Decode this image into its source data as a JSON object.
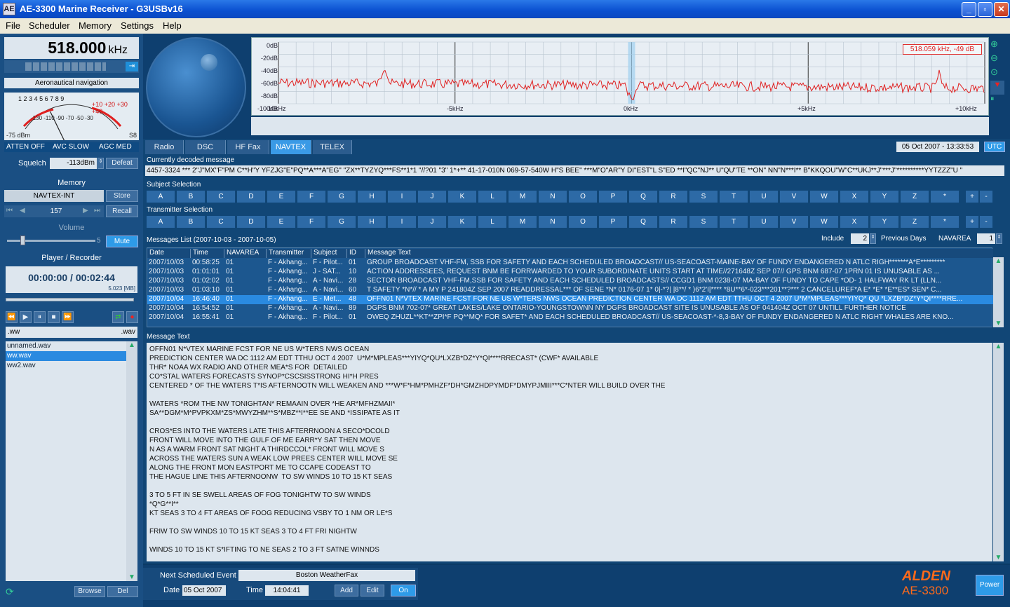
{
  "window": {
    "title": "AE-3300 Marine Receiver - G3USBv16",
    "icon": "AE",
    "min": "_",
    "max": "▫",
    "close": "✕"
  },
  "menu": [
    "File",
    "Scheduler",
    "Memory",
    "Settings",
    "Help"
  ],
  "freq": {
    "value": "518.000",
    "unit": "kHz",
    "mode_label": "Aeronautical navigation"
  },
  "meter": {
    "scale_left": [
      "1",
      "2",
      "3",
      "4",
      "5",
      "6",
      "7",
      "8",
      "9"
    ],
    "scale_right": [
      "+10",
      "+20",
      "+30",
      "+40"
    ],
    "scale_bottom": [
      "-130",
      "-110",
      "-90",
      "-70",
      "-50",
      "-30"
    ],
    "min_label": "-75",
    "unit": "dBm",
    "max_label": "S8",
    "atten": "ATTEN OFF",
    "avc": "AVC SLOW",
    "agc": "AGC MED",
    "needle_level": 0.38
  },
  "squelch": {
    "label": "Squelch",
    "value": "-113dBm",
    "defeat": "Defeat"
  },
  "memory": {
    "title": "Memory",
    "name": "NAVTEX-INT",
    "store": "Store",
    "number": "157",
    "recall": "Recall"
  },
  "volume": {
    "label": "Volume",
    "value": "5",
    "mute": "Mute",
    "level": 0.15
  },
  "player": {
    "title": "Player / Recorder",
    "time": "00:00:00 / 00:02:44",
    "size": "5.023 [MB]",
    "file": ".ww",
    "ext": ".wav",
    "files": [
      "unnamed.wav",
      "ww.wav",
      "ww2.wav"
    ],
    "selected": 1,
    "browse": "Browse",
    "del": "Del"
  },
  "spectrum": {
    "y_labels": [
      "0dB",
      "-20dB",
      "-40dB",
      "-60dB",
      "-80dB",
      "-100dB"
    ],
    "x_labels": [
      "-10kHz",
      "-5kHz",
      "0kHz",
      "+5kHz",
      "+10kHz"
    ],
    "readout": "518.059 kHz, -49 dB"
  },
  "tabs": [
    "Radio",
    "DSC",
    "HF Fax",
    "NAVTEX",
    "TELEX"
  ],
  "active_tab": 3,
  "datetime": "05 Oct 2007 - 13:33:53",
  "utc": "UTC",
  "decoded": {
    "label": "Currently decoded message",
    "text": "4457-3324 *** 2\"J\"MX\"F\"PM C**H\"Y YFZJG\"E\"PQ**A***A\"EG\" \"ZX**TYZYQ***FS**1*1 \"//?01 \"3\" 1*+** 41-17-010N 069-57-540W H\"S BEE\" ***M\"O\"AR\"Y DI\"EST\"L S\"ED **I\"QC\"NJ** U\"QU\"TE **ON\" NN\"N***I** B\"KKQOU\"W\"C**UKJ**J\"***J\"**********YYTZZZ\"U \""
  },
  "subject": {
    "label": "Subject Selection"
  },
  "transmitter": {
    "label": "Transmitter Selection"
  },
  "letters": [
    "A",
    "B",
    "C",
    "D",
    "E",
    "F",
    "G",
    "H",
    "I",
    "J",
    "K",
    "L",
    "M",
    "N",
    "O",
    "P",
    "Q",
    "R",
    "S",
    "T",
    "U",
    "V",
    "W",
    "X",
    "Y",
    "Z",
    "*"
  ],
  "plus": "+",
  "minus": "-",
  "messages": {
    "label": "Messages List (2007-10-03 - 2007-10-05)",
    "include_label": "Include",
    "include_value": "2",
    "prev_days": "Previous Days",
    "navarea_label": "NAVAREA",
    "navarea_value": "1",
    "columns": [
      "Date",
      "Time",
      "NAVAREA",
      "Transmitter",
      "Subject",
      "ID",
      "Message Text"
    ],
    "rows": [
      [
        "2007/10/03",
        "00:58:25",
        "01",
        "F - Akhang...",
        "F - Pilot...",
        "01",
        "GROUP BROADCAST VHF-FM, SSB    FOR SAFETY AND EACH SCHEDULED BROADCAST//    US-SEACOAST-MAINE-BAY OF FUNDY    ENDANGERED N ATLC RIGH*******A*E*********"
      ],
      [
        "2007/10/03",
        "01:01:01",
        "01",
        "F - Akhang...",
        "J - SAT...",
        "10",
        "ACTION ADDRESSEES, REQUEST BNM BE FORRWARDED TO YOUR   SUBORDINATE UNITS    START AT TIME//271648Z SEP 07//    GPS BNM 687-07    1PRN 01 IS UNUSABLE AS ..."
      ],
      [
        "2007/10/03",
        "01:02:02",
        "01",
        "F - Akhang...",
        "A - Navi...",
        "28",
        "SECTOR BROADCAST VHF-FM,SSB    FOR SAFETY AND EACH SCHEDULED BROADCASTS//    CCGD1 BNM 0238-07    MA-BAY OF FUNDY TO CAPE *OD-    1 HALFWAY RK LT (LLN..."
      ],
      [
        "2007/10/03",
        "01:03:10",
        "01",
        "F - Akhang...",
        "A - Navi...",
        "60",
        "T  SAFETY *N*// *  A MY P 241804Z SEP 2007 READDRESSAL***    OF SENE *N* 0176-07    1*  0|-*?| |8**/ * )6*2'I|**** *8U**6*-023***201**?***  2 CANCELUREF*A E*  *E* *E**ES* SEN* C..."
      ],
      [
        "2007/10/04",
        "16:46:40",
        "01",
        "F - Akhang...",
        "E - Met...",
        "48",
        "OFFN01 N*VTEX MARINE FCST FOR NE US W*TERS NWS OCEAN    PREDICTION CENTER WA DC 1112 AM EDT TTHU OCT 4 2007  U*M*MPLEAS***YIYQ* QU *LXZB*DZ*Y*QI****RRE..."
      ],
      [
        "2007/10/04",
        "16:54:52",
        "01",
        "F - Akhang...",
        "A - Navi...",
        "89",
        "DGPS BNM 702-07*    GREAT LAKES/LAKE ONTARIO-YOUNGSTOWNN NY DGPS BROADCAST SITE IS       UNUSABLE AS OF 041404Z OCT 07 UNTILL FURTHER NOTICE"
      ],
      [
        "2007/10/04",
        "16:55:41",
        "01",
        "F - Akhang...",
        "F - Pilot...",
        "01",
        "OWEQ  ZHUZL**KT**ZPI*F PQ**MQ*    FOR SAFET* AND EACH SCHEDULED BROADCAST//    US-SEACOAST-*-8,3-BAY OF FUNDY    ENDANGERED N ATLC RIGHT WHALES ARE KNO..."
      ]
    ],
    "selected_row": 4
  },
  "message_text": {
    "label": "Message Text",
    "lines": [
      "OFFN01 N*VTEX MARINE FCST FOR NE US W*TERS NWS OCEAN",
      "PREDICTION CENTER WA DC 1112 AM EDT TTHU OCT 4 2007  U*M*MPLEAS***YIYQ*QU*LXZB*DZ*Y*QI****RRECAST* (CWF* AVAILABLE",
      "THR* NOAA WX RADIO AND OTHER MEA*S FOR  DETAILED",
      "CO*STAL WATERS FORECASTS SYNOP*CSCSISSTRONG HI*H PRES",
      "CENTERED * OF THE WATERS T*IS AFTERNOOTN WILL WEAKEN AND ***W*F*HM*PMHZF*DH*GMZHDPYMDF*DMYPJMIII***C*NTER WILL BUILD OVER THE",
      "",
      "WATERS *ROM THE NW TONIGHTAN* REMAAIN OVER *HE AR*MFHZMAII*",
      "SA**DGM*M*PVPKXM*ZS*MWYZHM**S*MBZ**I**EE SE AND *ISSIPATE AS IT",
      "",
      "CROS*ES INTO THE WATERS LATE THIS AFTERRNOON A SECO*DCOLD",
      "FRONT WILL MOVE INTO THE GULF OF ME EARR*Y SAT THEN MOVE",
      "N AS A WARM FRONT SAT NIGHT A THIRDCCOL* FRONT WILL MOVE S",
      "ACROSS THE WATERS SUN A WEAK LOW PREES CENTER WILL MOVE SE",
      "ALONG THE FRONT MON EASTPORT ME TO CCAPE CODEAST TO",
      "THE HAGUE LINE THIS AFTERNOONW  TO SW WINDS 10 TO 15 KT SEAS",
      "",
      "3 TO 5 FT IN SE SWELL AREAS OF FOG TONIGHTW TO SW WINDS",
      "*Q*G**I**",
      "KT SEAS 3 TO 4 FT AREAS OF FOOG REDUCING VSBY TO 1 NM OR LE*S",
      "",
      "FRIW TO SW WINDS 10 TO 15 KT SEAS 3 TO 4 FT FRI NIGHTW",
      "",
      "WINDS 10 TO 15 KT S*IFTING TO NE SEAS 2 TO 3 FT SATNE WINNDS"
    ]
  },
  "schedule": {
    "next_label": "Next Scheduled Event",
    "next_value": "Boston WeatherFax",
    "date_label": "Date",
    "date_value": "05 Oct 2007",
    "time_label": "Time",
    "time_value": "14:04:41",
    "add": "Add",
    "edit": "Edit",
    "on": "On"
  },
  "brand": {
    "name": "ALDEN",
    "model": "AE-3300",
    "power": "Power"
  },
  "colors": {
    "bg": "#0b3a66",
    "panel": "#1a4f83",
    "accent": "#3a9ae6",
    "spectrum_trace": "#e02020",
    "brand": "#ff6a1a"
  }
}
